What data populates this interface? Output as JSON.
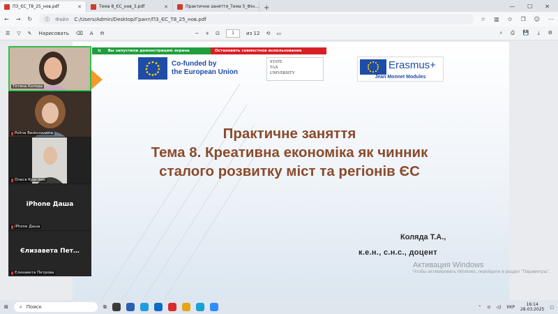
{
  "browser": {
    "tabs": [
      {
        "label": "П3_ЄС_Т8_25_нов.pdf",
        "active": true
      },
      {
        "label": "Тема 8_ЄС_нов_3.pdf",
        "active": false
      },
      {
        "label": "Практичне заняття_Тема 5_Фін…",
        "active": false
      }
    ],
    "new_tab": "+",
    "win_controls": [
      "—",
      "☐",
      "✕"
    ],
    "address": {
      "scheme": "Файл",
      "path": "C:/Users/Admin/Desktop/Грант/П3_ЄС_Т8_25_нов.pdf"
    }
  },
  "pdf_toolbar": {
    "draw_label": "Нарисовать",
    "page_current": "1",
    "page_total": "из 12"
  },
  "share_banner": {
    "status": "Вы запустили демонстрацию экрана",
    "stop": "Остановить совместное использование"
  },
  "participants": [
    {
      "name": "Тетяна Коляда",
      "big": ""
    },
    {
      "name": "Polina Beskorovaina",
      "big": ""
    },
    {
      "name": "Олеся Круглюк",
      "big": ""
    },
    {
      "name": "iPhone Даша",
      "big": "iPhone Даша"
    },
    {
      "name": "Єлизавета Петрова",
      "big": "Єлизавета Пет…"
    }
  ],
  "slide": {
    "eu_logo": [
      "Co-funded by",
      "the European Union"
    ],
    "stu_logo": [
      "STATE",
      "TAX",
      "UNIVERSITY"
    ],
    "erasmus_word": "Erasmus+",
    "erasmus_sub": "Jean Monnet Modules",
    "title_lines": [
      "Практичне заняття",
      "Тема 8. Креативна економіка як чинник",
      "сталого розвитку міст та регіонів ЄС"
    ],
    "author": "Коляда Т.А.,",
    "degree": "к.е.н., с.н.с., доцент"
  },
  "watermark": {
    "line1": "Активация Windows",
    "line2": "Чтобы активировать Windows, перейдите в раздел \"Параметры\"."
  },
  "taskbar": {
    "search": "Поиск",
    "lang": "УКР",
    "time": "16:14",
    "date": "28.03.2025"
  }
}
